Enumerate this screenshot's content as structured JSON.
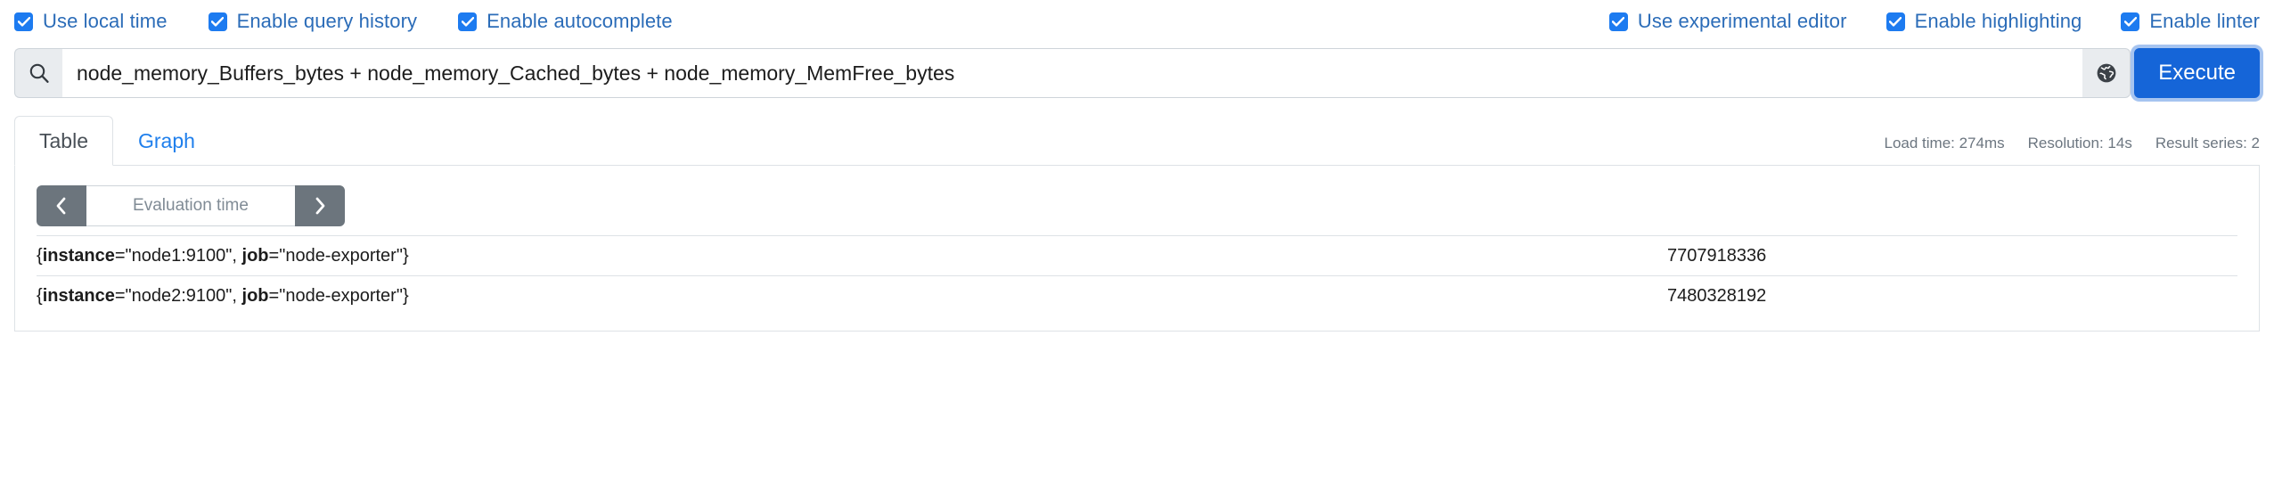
{
  "options": {
    "left": [
      {
        "label": "Use local time",
        "checked": true,
        "name": "use-local-time"
      },
      {
        "label": "Enable query history",
        "checked": true,
        "name": "enable-query-history"
      },
      {
        "label": "Enable autocomplete",
        "checked": true,
        "name": "enable-autocomplete"
      }
    ],
    "right": [
      {
        "label": "Use experimental editor",
        "checked": true,
        "name": "use-experimental-editor"
      },
      {
        "label": "Enable highlighting",
        "checked": true,
        "name": "enable-highlighting"
      },
      {
        "label": "Enable linter",
        "checked": true,
        "name": "enable-linter"
      }
    ]
  },
  "query": {
    "expression": "node_memory_Buffers_bytes + node_memory_Cached_bytes + node_memory_MemFree_bytes",
    "placeholder": "Expression (press Shift+Enter for newlines)",
    "search_icon": "search-icon",
    "globe_icon": "globe-icon",
    "execute_label": "Execute"
  },
  "tabs": [
    {
      "label": "Table",
      "active": true
    },
    {
      "label": "Graph",
      "active": false
    }
  ],
  "meta": {
    "load_time": "Load time: 274ms",
    "resolution": "Resolution: 14s",
    "result_series": "Result series: 2"
  },
  "time_control": {
    "prev_icon": "chevron-left-icon",
    "next_icon": "chevron-right-icon",
    "placeholder": "Evaluation time",
    "value": ""
  },
  "results": {
    "rows": [
      {
        "labels": [
          {
            "key": "instance",
            "value": "\"node1:9100\""
          },
          {
            "key": "job",
            "value": "\"node-exporter\""
          }
        ],
        "value": "7707918336"
      },
      {
        "labels": [
          {
            "key": "instance",
            "value": "\"node2:9100\""
          },
          {
            "key": "job",
            "value": "\"node-exporter\""
          }
        ],
        "value": "7480328192"
      }
    ]
  },
  "colors": {
    "accent": "#1565d8",
    "checkbox": "#1d7bf0",
    "link": "#1f7fec",
    "gray_button": "#6c757d",
    "border": "#dee2e6"
  }
}
